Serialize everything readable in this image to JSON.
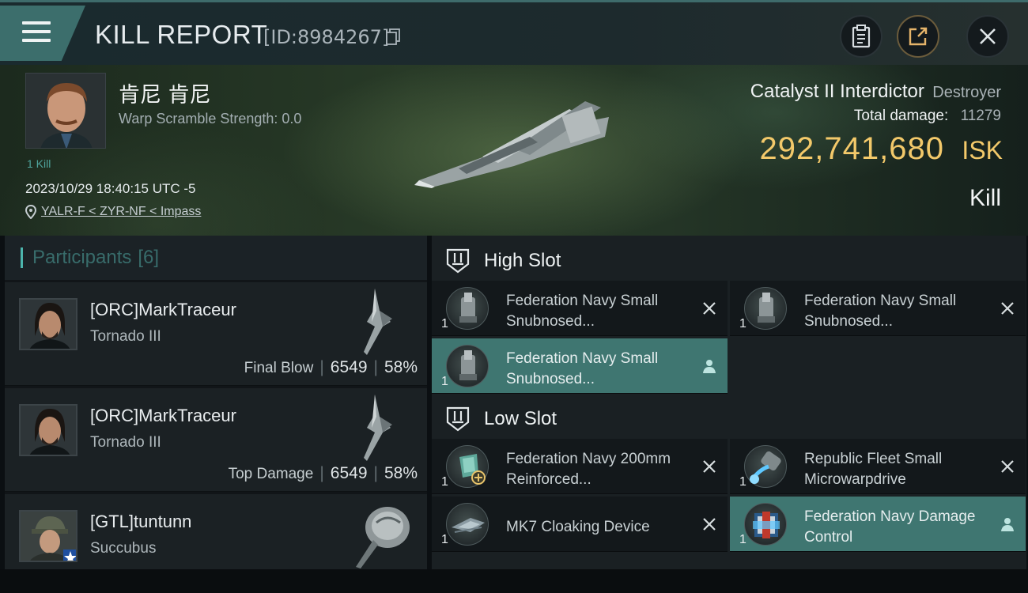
{
  "header": {
    "title": "KILL REPORT",
    "id_text": "[ID:8984267]"
  },
  "victim": {
    "name": "肯尼 肯尼",
    "warp_scramble": "Warp Scramble Strength: 0.0",
    "kill_count": "1 Kill",
    "time": "2023/10/29 18:40:15 UTC -5",
    "location": "YALR-F < ZYR-NF < Impass",
    "ship_name": "Catalyst II Interdictor",
    "ship_class": "Destroyer",
    "total_damage_label": "Total damage:",
    "total_damage": "11279",
    "isk_value": "292,741,680",
    "isk_unit": "ISK",
    "kill_type": "Kill"
  },
  "participants": {
    "label": "Participants",
    "count": "[6]",
    "rows": [
      {
        "name": "[ORC]MarkTraceur",
        "ship": "Tornado III",
        "role": "Final Blow",
        "damage": "6549",
        "percent": "58%"
      },
      {
        "name": "[ORC]MarkTraceur",
        "ship": "Tornado III",
        "role": "Top Damage",
        "damage": "6549",
        "percent": "58%"
      },
      {
        "name": "[GTL]tuntunn",
        "ship": "Succubus"
      }
    ]
  },
  "fitting": {
    "high_slot_label": "High Slot",
    "low_slot_label": "Low Slot",
    "high": [
      {
        "name": "Federation Navy Small Snubnosed...",
        "qty": "1",
        "state": "destroyed"
      },
      {
        "name": "Federation Navy Small Snubnosed...",
        "qty": "1",
        "state": "destroyed"
      },
      {
        "name": "Federation Navy Small Snubnosed...",
        "qty": "1",
        "state": "dropped"
      }
    ],
    "low": [
      {
        "name": "Federation Navy 200mm Reinforced...",
        "qty": "1",
        "state": "destroyed"
      },
      {
        "name": "Republic Fleet Small Microwarpdrive",
        "qty": "1",
        "state": "destroyed"
      },
      {
        "name": "MK7 Cloaking Device",
        "qty": "1",
        "state": "destroyed"
      },
      {
        "name": "Federation Navy Damage Control",
        "qty": "1",
        "state": "dropped"
      }
    ]
  },
  "icons": {
    "menu": "hamburger-icon",
    "copy": "copy-icon",
    "clipboard": "clipboard-icon",
    "share": "share-icon",
    "close": "close-icon",
    "location": "location-pin-icon",
    "destroyed": "x-icon",
    "dropped": "person-icon"
  },
  "colors": {
    "accent": "#4cb5ad",
    "isk": "#f3c96a",
    "active_module": "#3f7671"
  }
}
